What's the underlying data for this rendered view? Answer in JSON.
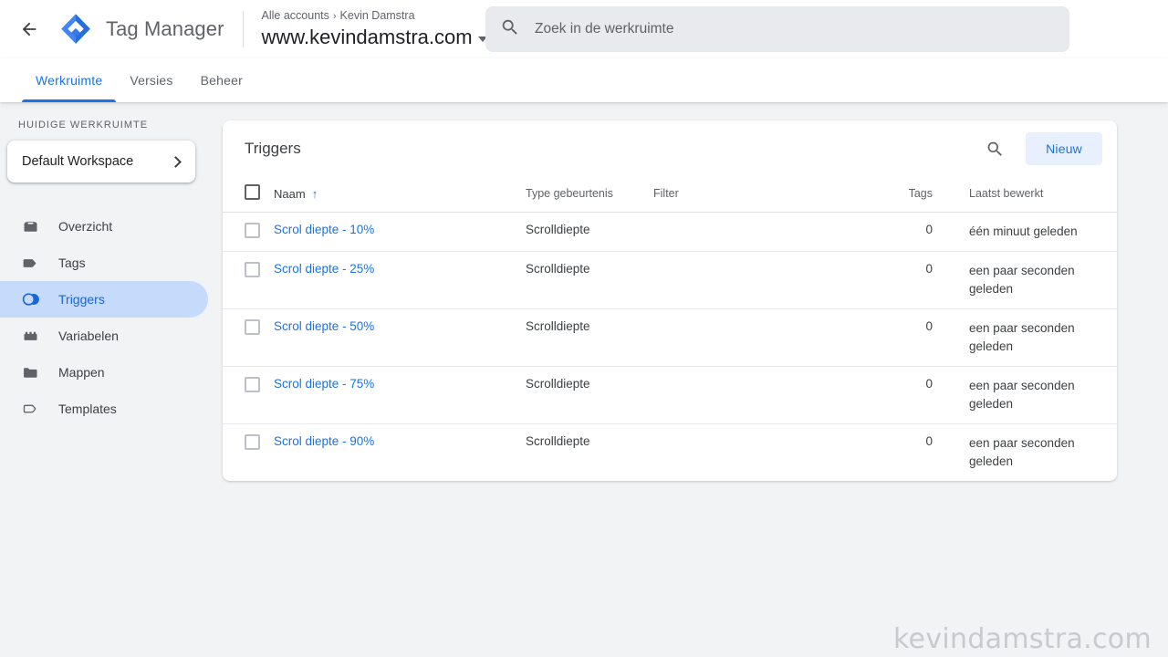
{
  "topbar": {
    "back_icon": "arrow-left-icon",
    "logo_icon": "tag-manager-logo",
    "product_name": "Tag Manager",
    "breadcrumb_root": "Alle accounts",
    "breadcrumb_sep": "›",
    "breadcrumb_account": "Kevin Damstra",
    "container_name": "www.kevindamstra.com",
    "search_placeholder": "Zoek in de werkruimte",
    "search_value": "",
    "search_icon": "search-icon"
  },
  "tabs": [
    {
      "label": "Werkruimte",
      "active": true
    },
    {
      "label": "Versies",
      "active": false
    },
    {
      "label": "Beheer",
      "active": false
    }
  ],
  "sidebar": {
    "section_label": "HUIDIGE WERKRUIMTE",
    "workspace_name": "Default Workspace",
    "workspace_chevron": "chevron-right-icon",
    "items": [
      {
        "label": "Overzicht",
        "icon": "overview-icon",
        "active": false
      },
      {
        "label": "Tags",
        "icon": "tag-icon",
        "active": false
      },
      {
        "label": "Triggers",
        "icon": "trigger-icon",
        "active": true
      },
      {
        "label": "Variabelen",
        "icon": "variable-icon",
        "active": false
      },
      {
        "label": "Mappen",
        "icon": "folder-icon",
        "active": false
      },
      {
        "label": "Templates",
        "icon": "template-icon",
        "active": false
      }
    ]
  },
  "main": {
    "card_title": "Triggers",
    "search_icon": "search-icon",
    "new_button": "Nieuw",
    "columns": {
      "name": "Naam",
      "sort_arrow": "↑",
      "type": "Type gebeurtenis",
      "filter": "Filter",
      "tags": "Tags",
      "last_edited": "Laatst bewerkt"
    },
    "rows": [
      {
        "name": "Scrol diepte - 10%",
        "type": "Scrolldiepte",
        "filter": "",
        "tags": "0",
        "last_edited": "één minuut geleden"
      },
      {
        "name": "Scrol diepte - 25%",
        "type": "Scrolldiepte",
        "filter": "",
        "tags": "0",
        "last_edited": "een paar seconden geleden"
      },
      {
        "name": "Scrol diepte - 50%",
        "type": "Scrolldiepte",
        "filter": "",
        "tags": "0",
        "last_edited": "een paar seconden geleden"
      },
      {
        "name": "Scrol diepte - 75%",
        "type": "Scrolldiepte",
        "filter": "",
        "tags": "0",
        "last_edited": "een paar seconden geleden"
      },
      {
        "name": "Scrol diepte - 90%",
        "type": "Scrolldiepte",
        "filter": "",
        "tags": "0",
        "last_edited": "een paar seconden geleden"
      }
    ]
  },
  "watermark": "kevindamstra.com",
  "colors": {
    "accent": "#1a73e8",
    "accent_soft": "#e8f0fe",
    "active_nav": "#c6dafc",
    "page_bg": "#f1f3f4",
    "text": "#3c4043",
    "muted": "#5f6368"
  }
}
